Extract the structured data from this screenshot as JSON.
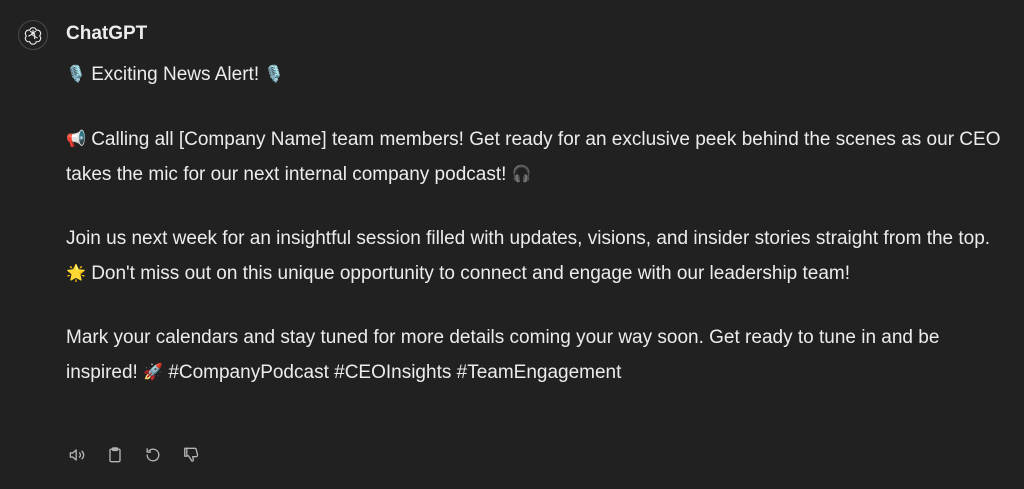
{
  "message": {
    "author": "ChatGPT",
    "avatar_icon": "openai-logo-icon",
    "paragraphs": [
      {
        "lead_emoji": "🎙️",
        "text": "Exciting News Alert!",
        "trail_emoji": "🎙️"
      },
      {
        "lead_emoji": "📢",
        "text": "Calling all [Company Name] team members! Get ready for an exclusive peek behind the scenes as our CEO takes the mic for our next internal company podcast!",
        "trail_emoji": "🎧"
      },
      {
        "text_before": "Join us next week for an insightful session filled with updates, visions, and insider stories straight from the top.",
        "mid_emoji": "🌟",
        "text_after": "Don't miss out on this unique opportunity to connect and engage with our leadership team!"
      },
      {
        "text_before": "Mark your calendars and stay tuned for more details coming your way soon. Get ready to tune in and be inspired!",
        "mid_emoji": "🚀",
        "text_after": "#CompanyPodcast #CEOInsights #TeamEngagement"
      }
    ]
  },
  "actions": [
    {
      "icon": "speaker-icon"
    },
    {
      "icon": "clipboard-icon"
    },
    {
      "icon": "regenerate-icon"
    },
    {
      "icon": "thumbs-down-icon"
    }
  ],
  "colors": {
    "background": "#212121",
    "text": "#ececec",
    "icon": "#b4b4b4"
  }
}
